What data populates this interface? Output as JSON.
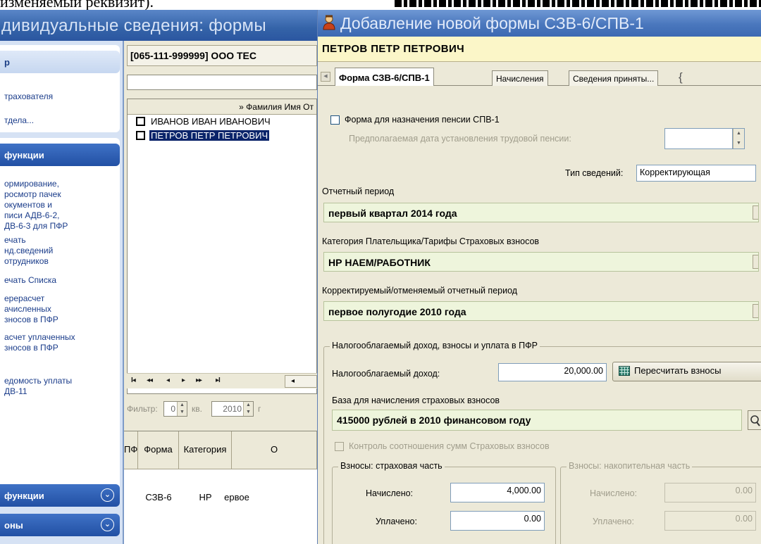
{
  "doc_strip": {
    "text": "изменяемый реквизит)."
  },
  "bg_window": {
    "title": "дивидуальные сведения: формы",
    "sidebar": {
      "top_head": "р",
      "top_items": [
        "трахователя",
        "тдела..."
      ],
      "functions_head": "функции",
      "items": [
        "ормирование,\nросмотр пачек\nокументов и\nписи АДВ-6-2,\nДВ-6-3 для ПФР",
        "ечать\nнд.сведений\nотрудников",
        "ечать Списка",
        "ерерасчет\nачисленных\nзносов в ПФР",
        "асчет уплаченных\nзносов в ПФР",
        "едомость уплаты\nДВ-11"
      ],
      "bottom_heads": [
        "функции",
        "оны"
      ]
    },
    "org": "[065-111-999999] ООО ТЕС",
    "employee_grid": {
      "column_header": "» Фамилия Имя От",
      "rows": [
        "ИВАНОВ ИВАН ИВАНОВИЧ",
        "ПЕТРОВ ПЕТР ПЕТРОВИЧ"
      ],
      "selected_index": 1
    },
    "nav": {
      "first": "I◂",
      "prev_page": "◂◂",
      "prev": "◂",
      "next": "▸",
      "next_page": "▸▸",
      "last": "▸I",
      "h_left": "◂"
    },
    "filter": {
      "label": "Фильтр:",
      "quarter": "0",
      "quarter_label": "кв.",
      "year": "2010",
      "year_suffix": "г"
    },
    "form_grid": {
      "headers": [
        "ПФ",
        "Форма",
        "Категория",
        "О"
      ],
      "row": {
        "pf": "",
        "form": "СЗВ-6",
        "category": "НР",
        "o": "ервое"
      }
    }
  },
  "dialog": {
    "title": "Добавление новой формы СЗВ-6/СПВ-1",
    "person": "ПЕТРОВ ПЕТР ПЕТРОВИЧ",
    "tabs": [
      "Форма СЗВ-6/СПВ-1",
      "Начисления",
      "Сведения приняты..."
    ],
    "active_tab": 0,
    "spv1_checkbox_label": "Форма для назначения пенсии СПВ-1",
    "spv1_checked": false,
    "pension_date_label": "Предполагаемая дата установления трудовой пенсии:",
    "pension_date_value": "",
    "info_type_label": "Тип сведений:",
    "info_type_value": "Корректирующая",
    "report_period_label": "Отчетный период",
    "report_period_value": "первый квартал 2014 года",
    "category_label": "Категория Плательщика/Тарифы Страховых взносов",
    "category_value": "НР НАЕМ/РАБОТНИК",
    "corrected_period_label": "Корректируемый/отменяемый отчетный период",
    "corrected_period_value": "первое полугодие 2010 года",
    "income_group": {
      "title": "Налогооблагаемый доход, взносы и уплата в ПФР",
      "income_label": "Налогооблагаемый доход:",
      "income_value": "20,000.00",
      "recalc_button": "Пересчитать взносы",
      "base_label": "База для начисления страховых взносов",
      "base_value": "415000 рублей в 2010 финансовом году",
      "control_label": "Контроль соотношения сумм Страховых взносов",
      "control_checked": false
    },
    "insurance": {
      "title": "Взносы: страховая часть",
      "accrued_label": "Начислено:",
      "accrued_value": "4,000.00",
      "paid_label": "Уплачено:",
      "paid_value": "0.00"
    },
    "funded": {
      "title": "Взносы: накопительная часть",
      "accrued_label": "Начислено:",
      "accrued_value": "0.00",
      "paid_label": "Уплачено:",
      "paid_value": "0.00"
    }
  },
  "colors": {
    "titlebar": "#3463a8",
    "person_bar": "#fbf6c8",
    "field_green": "#eef5dc",
    "selection": "#0a246a"
  }
}
